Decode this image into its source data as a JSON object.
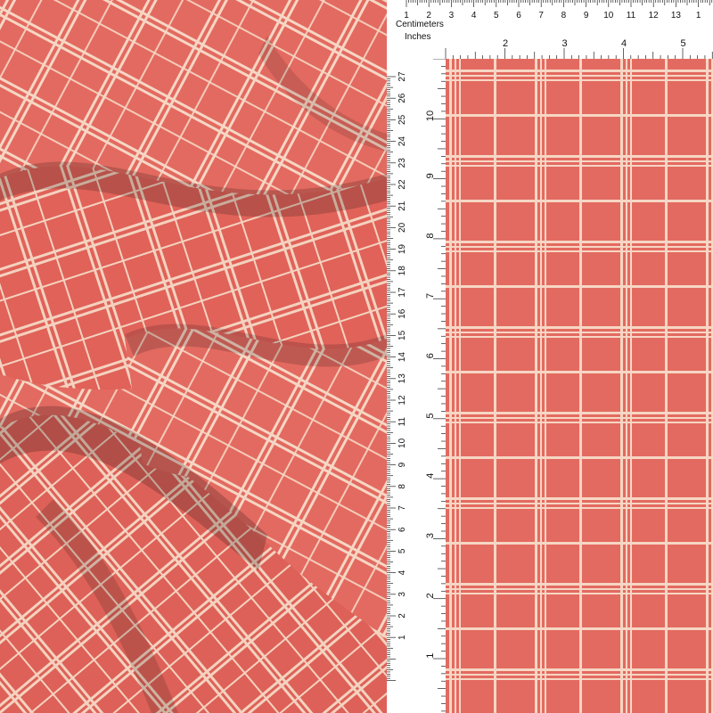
{
  "ruler": {
    "centimeters_label": "Centimeters",
    "inches_label": "Inches",
    "top_cm_marks": [
      "1",
      "2",
      "3",
      "4",
      "5",
      "6",
      "7",
      "8",
      "9",
      "10",
      "11",
      "12",
      "13",
      "1"
    ],
    "top_in_marks": [
      "2",
      "3",
      "4",
      "5"
    ],
    "left_cm_marks": [
      "27",
      "26",
      "25",
      "24",
      "23",
      "22",
      "21",
      "20",
      "19",
      "18",
      "17",
      "16",
      "15",
      "14",
      "13",
      "12",
      "11",
      "10",
      "9",
      "8",
      "7",
      "6",
      "5",
      "4",
      "3",
      "2",
      "1"
    ],
    "left_in_marks": [
      "10",
      "9",
      "8",
      "7",
      "6",
      "5",
      "4",
      "3",
      "2",
      "1"
    ]
  },
  "fabric": {
    "base_color": "#e36a60",
    "line_color": "#f6d6c4",
    "ruler_bg": "#ffffff"
  }
}
